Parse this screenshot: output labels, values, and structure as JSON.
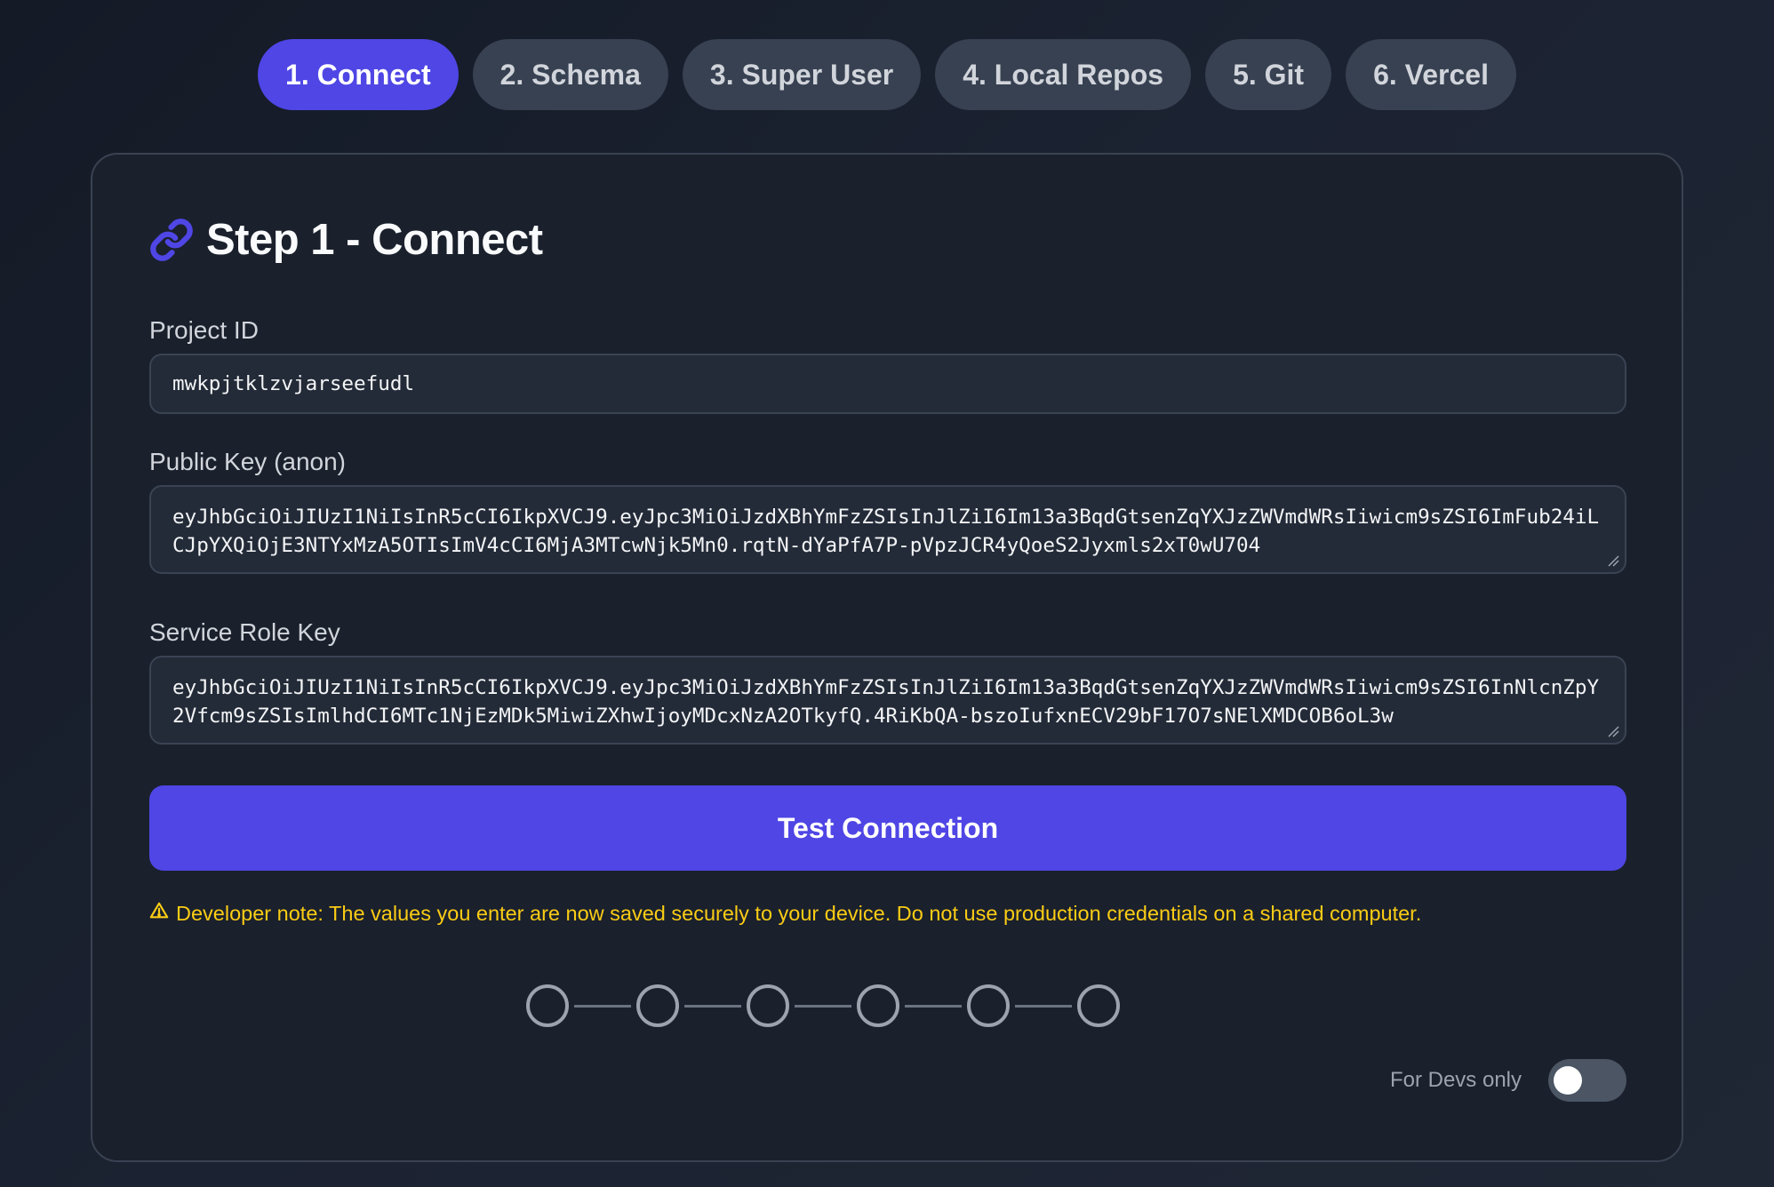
{
  "tabs": [
    {
      "label": "1. Connect",
      "active": true
    },
    {
      "label": "2. Schema",
      "active": false
    },
    {
      "label": "3. Super User",
      "active": false
    },
    {
      "label": "4. Local Repos",
      "active": false
    },
    {
      "label": "5. Git",
      "active": false
    },
    {
      "label": "6. Vercel",
      "active": false
    }
  ],
  "card": {
    "icon": "link-icon",
    "title": "Step 1 - Connect"
  },
  "fields": {
    "project_id": {
      "label": "Project ID",
      "value": "mwkpjtklzvjarseefudl"
    },
    "public_key": {
      "label": "Public Key (anon)",
      "value": "eyJhbGciOiJIUzI1NiIsInR5cCI6IkpXVCJ9.eyJpc3MiOiJzdXBhYmFzZSIsInJlZiI6Im13a3BqdGtsenZqYXJzZWVmdWRsIiwicm9sZSI6ImFub24iLCJpYXQiOjE3NTYxMzA5OTIsImV4cCI6MjA3MTcwNjk5Mn0.rqtN-dYaPfA7P-pVpzJCR4yQoeS2Jyxmls2xT0wU704"
    },
    "service_role_key": {
      "label": "Service Role Key",
      "value": "eyJhbGciOiJIUzI1NiIsInR5cCI6IkpXVCJ9.eyJpc3MiOiJzdXBhYmFzZSIsInJlZiI6Im13a3BqdGtsenZqYXJzZWVmdWRsIiwicm9sZSI6InNlcnZpY2Vfcm9sZSIsImlhdCI6MTc1NjEzMDk5MiwiZXhwIjoyMDcxNzA2OTkyfQ.4RiKbQA-bszoIufxnECV29bF17O7sNElXMDCOB6oL3w"
    }
  },
  "actions": {
    "test_connection_label": "Test Connection"
  },
  "note": {
    "icon": "warning-icon",
    "text": "Developer note: The values you enter are now saved securely to your device. Do not use production credentials on a shared computer."
  },
  "stepper": {
    "total_steps": 6,
    "completed_steps": 0
  },
  "dev_toggle": {
    "label": "For Devs only",
    "enabled": false
  },
  "colors": {
    "accent": "#4f46e5",
    "warning": "#facc15",
    "background": "#1a202c"
  }
}
